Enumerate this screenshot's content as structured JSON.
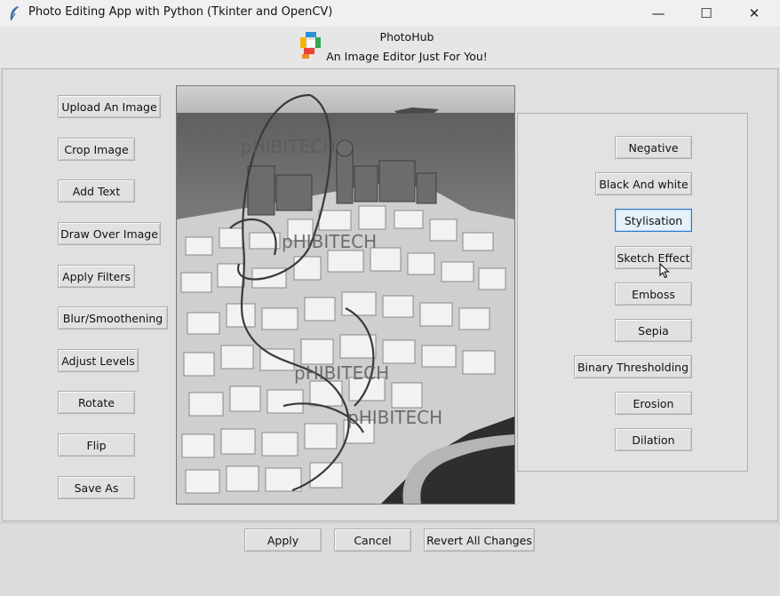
{
  "window": {
    "title": "Photo Editing App with Python (Tkinter and OpenCV)",
    "controls": {
      "minimize": "—",
      "maximize": "☐",
      "close": "✕"
    }
  },
  "header": {
    "app_name": "PhotoHub",
    "tagline": "An Image Editor Just For You!"
  },
  "tools": [
    "Upload An Image",
    "Crop Image",
    "Add Text",
    "Draw Over Image",
    "Apply Filters",
    "Blur/Smoothening",
    "Adjust Levels",
    "Rotate",
    "Flip",
    "Save As"
  ],
  "filters": [
    "Negative",
    "Black And white",
    "Stylisation",
    "Sketch Effect",
    "Emboss",
    "Sepia",
    "Binary Thresholding",
    "Erosion",
    "Dilation"
  ],
  "image": {
    "watermarks": [
      "pHIBITECH",
      "pHIBITECH",
      "pHIBITECH",
      "pHIBITECH"
    ]
  },
  "footer": {
    "apply": "Apply",
    "cancel": "Cancel",
    "revert": "Revert All Changes"
  }
}
